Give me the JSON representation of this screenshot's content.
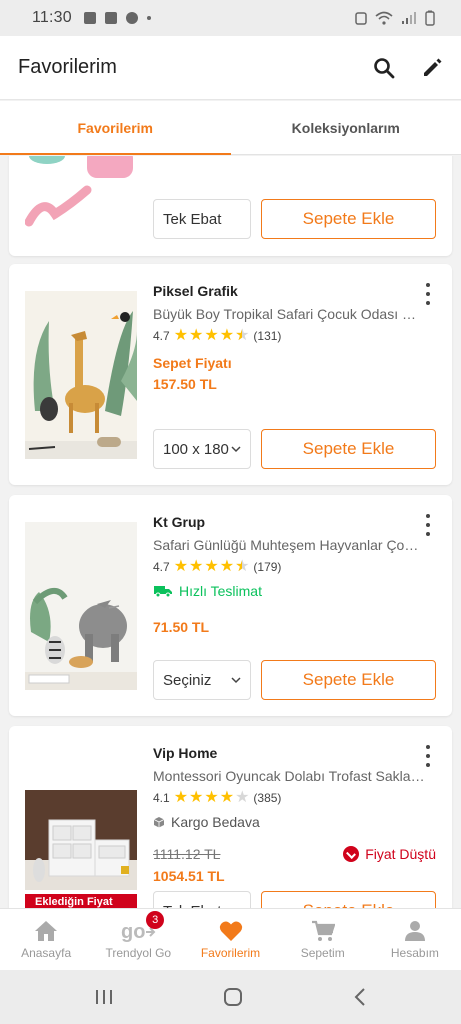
{
  "status": {
    "time": "11:30"
  },
  "header": {
    "title": "Favorilerim"
  },
  "tabs": [
    {
      "label": "Favorilerim",
      "active": true
    },
    {
      "label": "Koleksiyonlarım",
      "active": false
    }
  ],
  "items": [
    {
      "variant": "Tek Ebat",
      "add_label": "Sepete Ekle"
    },
    {
      "brand": "Piksel Grafik",
      "name": "Büyük Boy Tropikal Safari Çocuk Odası Duvar Sticker",
      "rating": "4.7",
      "rating_value": 4.7,
      "review_count": "(131)",
      "tag": "Sepet Fiyatı",
      "price": "157.50 TL",
      "variant": "100 x 180",
      "add_label": "Sepete Ekle"
    },
    {
      "brand": "Kt Grup",
      "name": "Safari Günlüğü Muhteşem Hayvanlar Çocuk Odası",
      "rating": "4.7",
      "rating_value": 4.7,
      "review_count": "(179)",
      "tag": "Hızlı Teslimat",
      "price": "71.50 TL",
      "variant": "Seçiniz",
      "add_label": "Sepete Ekle"
    },
    {
      "brand": "Vip Home",
      "name": "Montessori Oyuncak Dolabı Trofast Saklama Dolabı",
      "rating": "4.1",
      "rating_value": 4.1,
      "review_count": "(385)",
      "tag": "Kargo Bedava",
      "old_price": "1111.12 TL",
      "price": "1054.51 TL",
      "price_drop": "Fiyat Düştü",
      "banner": "Eklediğin Fiyat",
      "variant": "Tek Ebat",
      "add_label": "Sepete Ekle"
    }
  ],
  "bottom_nav": [
    {
      "label": "Anasayfa",
      "icon": "home-icon"
    },
    {
      "label": "Trendyol Go",
      "icon": "go-icon",
      "badge": "3"
    },
    {
      "label": "Favorilerim",
      "icon": "heart-icon",
      "active": true
    },
    {
      "label": "Sepetim",
      "icon": "cart-icon"
    },
    {
      "label": "Hesabım",
      "icon": "user-icon"
    }
  ],
  "colors": {
    "accent": "#f27a1a",
    "green": "#0bc15c",
    "red": "#d0021b"
  }
}
